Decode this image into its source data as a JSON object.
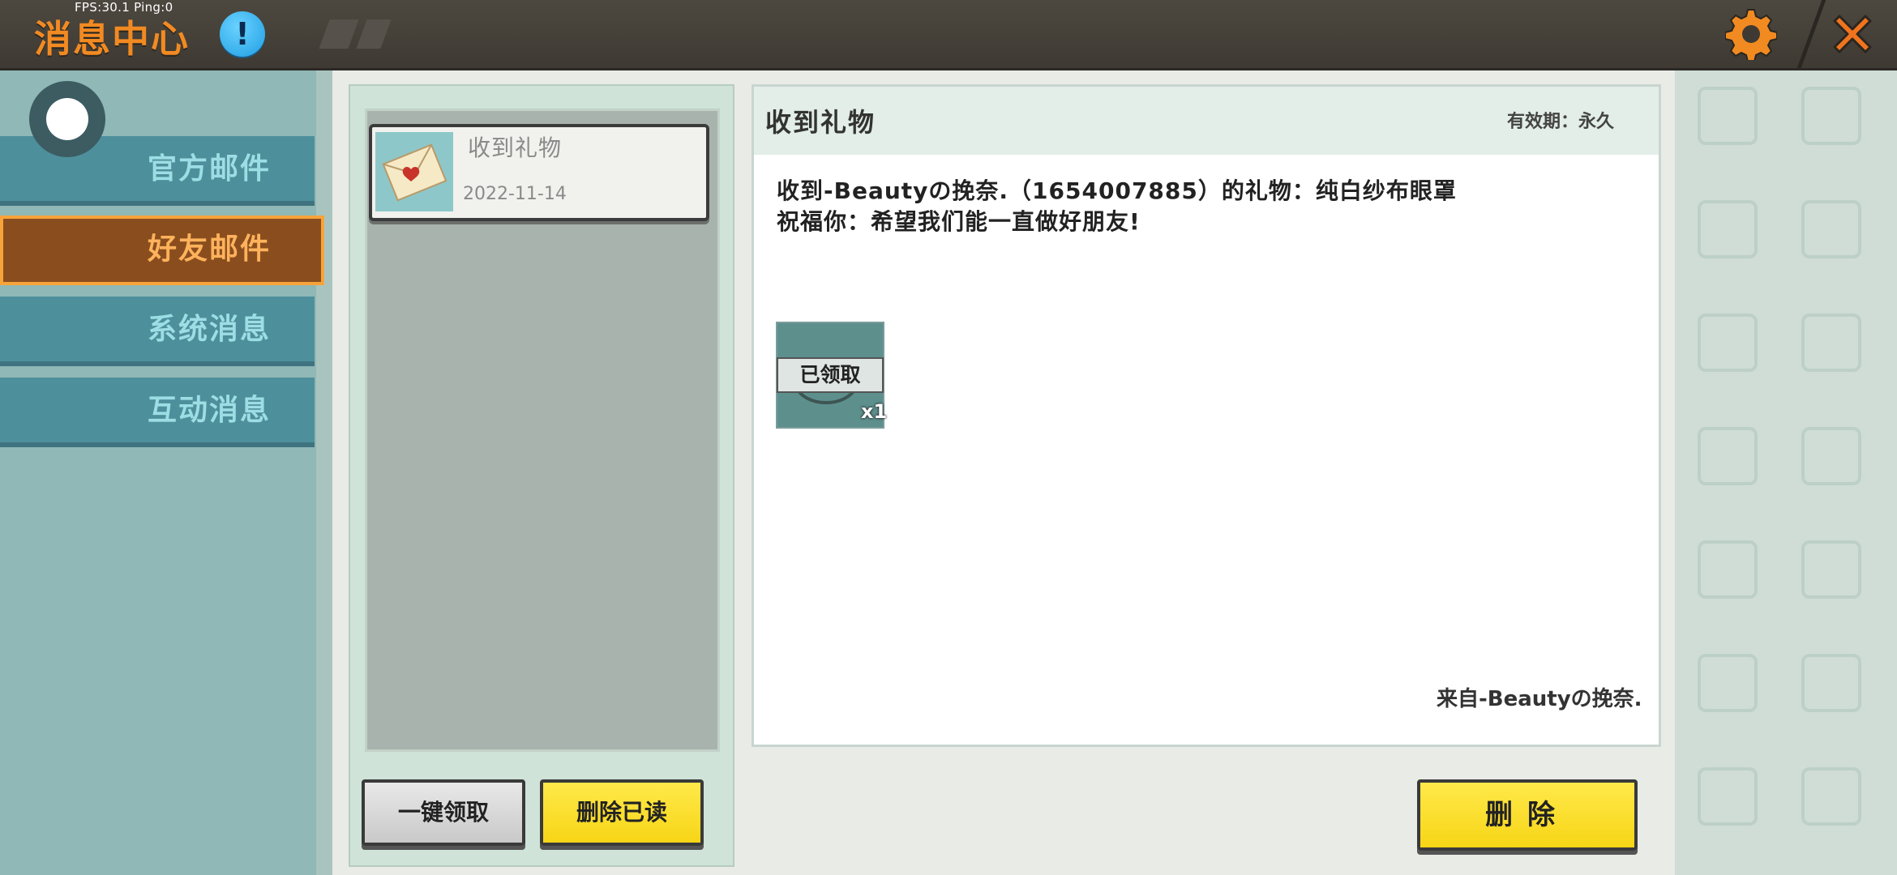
{
  "top_bar": {
    "fps_text": "FPS:30.1  Ping:0",
    "title": "消息中心",
    "info_symbol": "!"
  },
  "sidebar": {
    "tabs": [
      {
        "label": "官方邮件",
        "active": false
      },
      {
        "label": "好友邮件",
        "active": true
      },
      {
        "label": "系统消息",
        "active": false
      },
      {
        "label": "互动消息",
        "active": false
      }
    ]
  },
  "mail_list": {
    "items": [
      {
        "title": "收到礼物",
        "date": "2022-11-14"
      }
    ],
    "claim_all_label": "一键领取",
    "delete_read_label": "删除已读"
  },
  "detail": {
    "title": "收到礼物",
    "validity": "有效期：永久",
    "body_line_1": "收到-Beautyの挽奈.（1654007885）的礼物：纯白纱布眼罩",
    "body_line_2": "祝福你：希望我们能一直做好朋友!",
    "gift": {
      "claimed_label": "已领取",
      "count": "x1"
    },
    "sender": "来自-Beautyの挽奈.",
    "delete_label": "删除"
  },
  "colors": {
    "title_orange": "#f28a22",
    "active_tab": "#8a4e1e",
    "tab": "#4e8f9c",
    "yellow_button": "#f7d516"
  }
}
